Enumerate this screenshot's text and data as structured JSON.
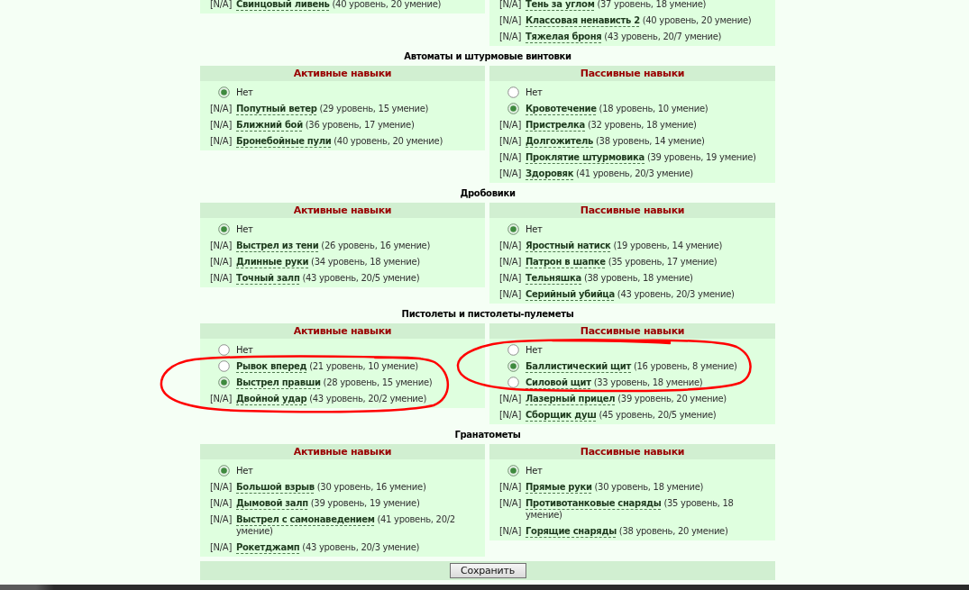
{
  "sections": [
    {
      "panels": [
        {
          "circled": false,
          "options": [
            {
              "kind": "na",
              "tag": "[N/A]",
              "name": "Свинцовый ливень",
              "detail": "(40 уровень, 20 умение)"
            }
          ]
        },
        {
          "circled": false,
          "options": [
            {
              "kind": "na",
              "tag": "[N/A]",
              "name": "Тень за углом",
              "detail": "(37 уровень, 18 умение)"
            },
            {
              "kind": "na",
              "tag": "[N/A]",
              "name": "Классовая ненависть 2",
              "detail": "(40 уровень, 20 умение)"
            },
            {
              "kind": "na",
              "tag": "[N/A]",
              "name": "Тяжелая броня",
              "detail": "(43 уровень, 20/7 умение)"
            }
          ]
        }
      ]
    },
    {
      "title": "Автоматы и штурмовые винтовки",
      "panels": [
        {
          "heading": "Активные навыки",
          "circled": false,
          "options": [
            {
              "kind": "radio",
              "selected": true,
              "label": "Нет"
            },
            {
              "kind": "na",
              "tag": "[N/A]",
              "name": "Попутный ветер",
              "detail": "(29 уровень, 15 умение)"
            },
            {
              "kind": "na",
              "tag": "[N/A]",
              "name": "Ближний бой",
              "detail": "(36 уровень, 17 умение)"
            },
            {
              "kind": "na",
              "tag": "[N/A]",
              "name": "Бронебойные пули",
              "detail": "(40 уровень, 20 умение)"
            }
          ]
        },
        {
          "heading": "Пассивные навыки",
          "circled": false,
          "options": [
            {
              "kind": "radio",
              "selected": false,
              "label": "Нет"
            },
            {
              "kind": "radio",
              "selected": true,
              "name": "Кровотечение",
              "detail": "(18 уровень, 10 умение)"
            },
            {
              "kind": "na",
              "tag": "[N/A]",
              "name": "Пристрелка",
              "detail": "(32 уровень, 18 умение)"
            },
            {
              "kind": "na",
              "tag": "[N/A]",
              "name": "Долгожитель",
              "detail": "(38 уровень, 14 умение)"
            },
            {
              "kind": "na",
              "tag": "[N/A]",
              "name": "Проклятие штурмовика",
              "detail": "(39 уровень, 19 умение)"
            },
            {
              "kind": "na",
              "tag": "[N/A]",
              "name": "Здоровяк",
              "detail": "(41 уровень, 20/3 умение)"
            }
          ]
        }
      ]
    },
    {
      "title": "Дробовики",
      "panels": [
        {
          "heading": "Активные навыки",
          "circled": false,
          "options": [
            {
              "kind": "radio",
              "selected": true,
              "label": "Нет"
            },
            {
              "kind": "na",
              "tag": "[N/A]",
              "name": "Выстрел из тени",
              "detail": "(26 уровень, 16 умение)"
            },
            {
              "kind": "na",
              "tag": "[N/A]",
              "name": "Длинные руки",
              "detail": "(34 уровень, 18 умение)"
            },
            {
              "kind": "na",
              "tag": "[N/A]",
              "name": "Точный залп",
              "detail": "(43 уровень, 20/5 умение)"
            }
          ]
        },
        {
          "heading": "Пассивные навыки",
          "circled": false,
          "options": [
            {
              "kind": "radio",
              "selected": true,
              "label": "Нет"
            },
            {
              "kind": "na",
              "tag": "[N/A]",
              "name": "Яростный натиск",
              "detail": "(19 уровень, 14 умение)"
            },
            {
              "kind": "na",
              "tag": "[N/A]",
              "name": "Патрон в шапке",
              "detail": "(35 уровень, 17 умение)"
            },
            {
              "kind": "na",
              "tag": "[N/A]",
              "name": "Тельняшка",
              "detail": "(38 уровень, 18 умение)"
            },
            {
              "kind": "na",
              "tag": "[N/A]",
              "name": "Серийный убийца",
              "detail": "(43 уровень, 20/3 умение)"
            }
          ]
        }
      ]
    },
    {
      "title": "Пистолеты и пистолеты-пулеметы",
      "panels": [
        {
          "heading": "Активные навыки",
          "circled": true,
          "options": [
            {
              "kind": "radio",
              "selected": false,
              "label": "Нет"
            },
            {
              "kind": "radio",
              "selected": false,
              "name": "Рывок вперед",
              "detail": "(21 уровень, 10 умение)"
            },
            {
              "kind": "radio",
              "selected": true,
              "name": "Выстрел правши",
              "detail": "(28 уровень, 15 умение)"
            },
            {
              "kind": "na",
              "tag": "[N/A]",
              "name": "Двойной удар",
              "detail": "(43 уровень, 20/2 умение)"
            }
          ]
        },
        {
          "heading": "Пассивные навыки",
          "circled": true,
          "options": [
            {
              "kind": "radio",
              "selected": false,
              "label": "Нет"
            },
            {
              "kind": "radio",
              "selected": true,
              "name": "Баллистический щит",
              "detail": "(16 уровень, 8 умение)"
            },
            {
              "kind": "radio",
              "selected": false,
              "name": "Силовой щит",
              "detail": "(33 уровень, 18 умение)"
            },
            {
              "kind": "na",
              "tag": "[N/A]",
              "name": "Лазерный прицел",
              "detail": "(39 уровень, 20 умение)"
            },
            {
              "kind": "na",
              "tag": "[N/A]",
              "name": "Сборщик душ",
              "detail": "(45 уровень, 20/5 умение)"
            }
          ]
        }
      ]
    },
    {
      "title": "Гранатометы",
      "panels": [
        {
          "heading": "Активные навыки",
          "circled": false,
          "options": [
            {
              "kind": "radio",
              "selected": true,
              "label": "Нет"
            },
            {
              "kind": "na",
              "tag": "[N/A]",
              "name": "Большой взрыв",
              "detail": "(30 уровень, 16 умение)"
            },
            {
              "kind": "na",
              "tag": "[N/A]",
              "name": "Дымовой залп",
              "detail": "(39 уровень, 19 умение)"
            },
            {
              "kind": "na",
              "tag": "[N/A]",
              "name": "Выстрел с самонаведением",
              "detail": "(41 уровень, 20/2 умение)"
            },
            {
              "kind": "na",
              "tag": "[N/A]",
              "name": "Рокетджамп",
              "detail": "(43 уровень, 20/3 умение)"
            }
          ]
        },
        {
          "heading": "Пассивные навыки",
          "circled": false,
          "options": [
            {
              "kind": "radio",
              "selected": true,
              "label": "Нет"
            },
            {
              "kind": "na",
              "tag": "[N/A]",
              "name": "Прямые руки",
              "detail": "(30 уровень, 18 умение)"
            },
            {
              "kind": "na",
              "tag": "[N/A]",
              "name": "Противотанковые снаряды",
              "detail": "(35 уровень, 18 умение)"
            },
            {
              "kind": "na",
              "tag": "[N/A]",
              "name": "Горящие снаряды",
              "detail": "(38 уровень, 20 умение)"
            }
          ]
        }
      ]
    }
  ],
  "save_button": "Сохранить"
}
